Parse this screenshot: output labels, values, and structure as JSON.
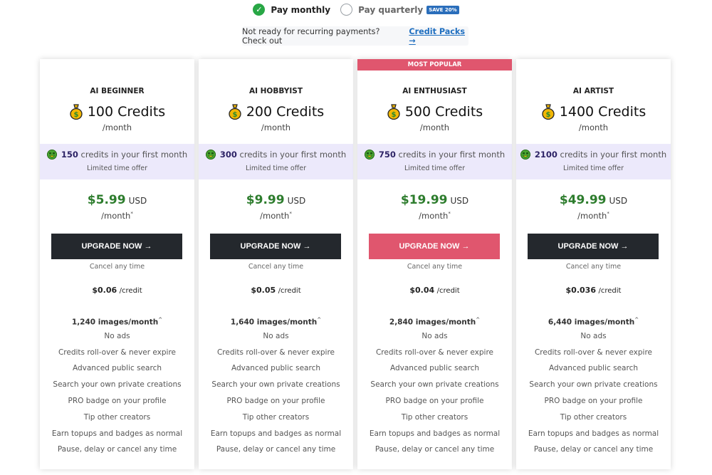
{
  "billing": {
    "monthly_label": "Pay monthly",
    "monthly_selected": true,
    "quarterly_label": "Pay quarterly",
    "quarterly_selected": false,
    "save_badge": "SAVE 20%"
  },
  "credit_note": {
    "text": "Not ready for recurring payments? Check out",
    "link_label": "Credit Packs →"
  },
  "colors": {
    "accent_popular": "#e0566e",
    "price_green": "#2e7d2e",
    "button_dark": "#24282d",
    "offer_bg": "#ece9fb",
    "link_blue": "#1f6fc0",
    "badge_blue": "#2a6ebb"
  },
  "icons": {
    "credits": "money-bag-icon",
    "offer": "money-mouth-face-icon",
    "selected": "check-circle-icon",
    "unselected": "empty-radio-icon"
  },
  "plans": [
    {
      "name": "AI BEGINNER",
      "credits": "100 Credits",
      "per": "/month",
      "offer_credits": "150",
      "offer_text": "credits in your first month",
      "offer_sub": "Limited time offer",
      "price": "$5.99",
      "currency": "USD",
      "price_per": "/month",
      "price_mark": "*",
      "button": "UPGRADE NOW →",
      "cancel": "Cancel any time",
      "per_credit": "$0.06",
      "per_credit_unit": "/credit",
      "images": "1,240 images/month",
      "images_mark": "^",
      "popular": false
    },
    {
      "name": "AI HOBBYIST",
      "credits": "200 Credits",
      "per": "/month",
      "offer_credits": "300",
      "offer_text": "credits in your first month",
      "offer_sub": "Limited time offer",
      "price": "$9.99",
      "currency": "USD",
      "price_per": "/month",
      "price_mark": "*",
      "button": "UPGRADE NOW →",
      "cancel": "Cancel any time",
      "per_credit": "$0.05",
      "per_credit_unit": "/credit",
      "images": "1,640 images/month",
      "images_mark": "^",
      "popular": false
    },
    {
      "name": "AI ENTHUSIAST",
      "banner": "MOST POPULAR",
      "credits": "500 Credits",
      "per": "/month",
      "offer_credits": "750",
      "offer_text": "credits in your first month",
      "offer_sub": "Limited time offer",
      "price": "$19.99",
      "currency": "USD",
      "price_per": "/month",
      "price_mark": "*",
      "button": "UPGRADE NOW →",
      "cancel": "Cancel any time",
      "per_credit": "$0.04",
      "per_credit_unit": "/credit",
      "images": "2,840 images/month",
      "images_mark": "^",
      "popular": true
    },
    {
      "name": "AI ARTIST",
      "credits": "1400 Credits",
      "per": "/month",
      "offer_credits": "2100",
      "offer_text": "credits in your first month",
      "offer_sub": "Limited time offer",
      "price": "$49.99",
      "currency": "USD",
      "price_per": "/month",
      "price_mark": "*",
      "button": "UPGRADE NOW →",
      "cancel": "Cancel any time",
      "per_credit": "$0.036",
      "per_credit_unit": "/credit",
      "images": "6,440 images/month",
      "images_mark": "^",
      "popular": false
    }
  ],
  "features": [
    "No ads",
    "Credits roll-over & never expire",
    "Advanced public search",
    "Search your own private creations",
    "PRO badge on your profile",
    "Tip other creators",
    "Earn topups and badges as normal",
    "Pause, delay or cancel any time"
  ]
}
